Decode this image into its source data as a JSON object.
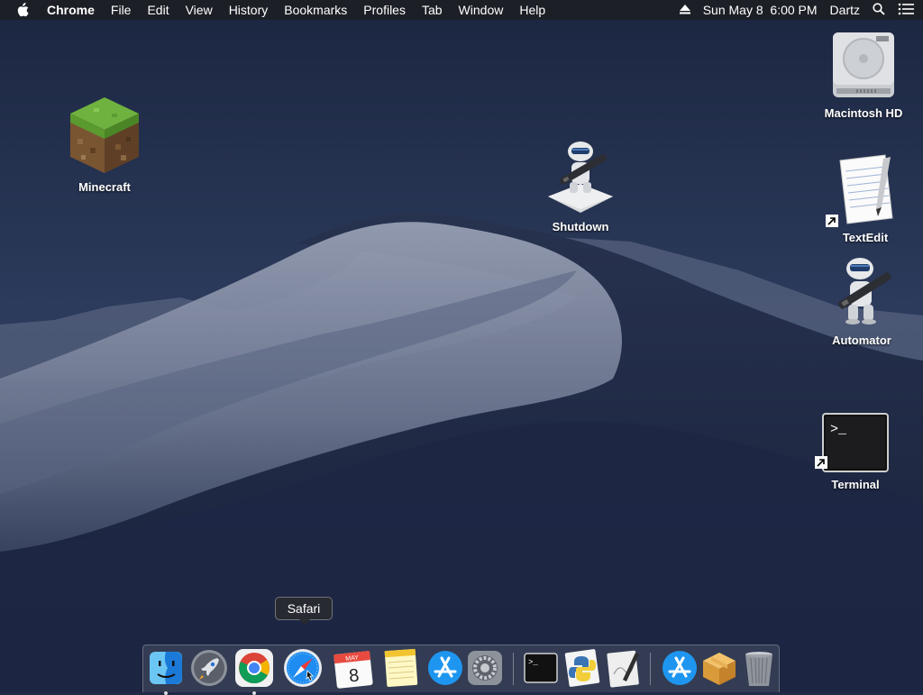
{
  "menubar": {
    "apple_icon": "apple-logo-icon",
    "app_name": "Chrome",
    "items": [
      "File",
      "Edit",
      "View",
      "History",
      "Bookmarks",
      "Profiles",
      "Tab",
      "Window",
      "Help"
    ],
    "datetime": "Sun May 8  6:00 PM",
    "user": "Dartz",
    "status_icons": [
      "eject-icon",
      "spotlight-search-icon",
      "notification-center-icon"
    ]
  },
  "desktop": {
    "icons": [
      {
        "label": "Minecraft",
        "icon": "minecraft-grass-block-icon"
      },
      {
        "label": "Shutdown",
        "icon": "automator-robot-icon"
      },
      {
        "label": "Macintosh HD",
        "icon": "hard-drive-icon"
      },
      {
        "label": "TextEdit",
        "icon": "textedit-icon"
      },
      {
        "label": "Automator",
        "icon": "automator-robot-icon"
      },
      {
        "label": "Terminal",
        "icon": "terminal-icon"
      }
    ]
  },
  "dock": {
    "tooltip": "Safari",
    "calendar": {
      "month": "MAY",
      "day": "8"
    },
    "terminal_prompt": ">_",
    "items": [
      {
        "name": "Finder",
        "icon": "finder-icon",
        "running": true
      },
      {
        "name": "Launchpad",
        "icon": "launchpad-rocket-icon",
        "running": false
      },
      {
        "name": "Google Chrome",
        "icon": "chrome-icon",
        "running": true
      },
      {
        "name": "Safari",
        "icon": "safari-compass-icon",
        "running": false
      },
      {
        "name": "Calendar",
        "icon": "calendar-icon",
        "running": false
      },
      {
        "name": "Notes",
        "icon": "notes-icon",
        "running": false
      },
      {
        "name": "App Store",
        "icon": "app-store-icon",
        "running": false
      },
      {
        "name": "System Preferences",
        "icon": "gear-icon",
        "running": false
      },
      {
        "name": "Terminal",
        "icon": "terminal-icon",
        "running": false
      },
      {
        "name": "Python Launcher",
        "icon": "python-icon",
        "running": false
      },
      {
        "name": "Script Editor",
        "icon": "script-editor-icon",
        "running": false
      },
      {
        "name": "App Store",
        "icon": "app-store-icon",
        "running": false
      },
      {
        "name": "Installer",
        "icon": "package-box-icon",
        "running": false
      },
      {
        "name": "Trash",
        "icon": "trash-icon",
        "running": false
      }
    ]
  },
  "colors": {
    "sky_top": "#1c2842",
    "sky_mid": "#2d3c5e",
    "dune_light": "#8a93a8",
    "dune_dark": "#1a2440",
    "menubar_bg": "#1c1e24"
  }
}
